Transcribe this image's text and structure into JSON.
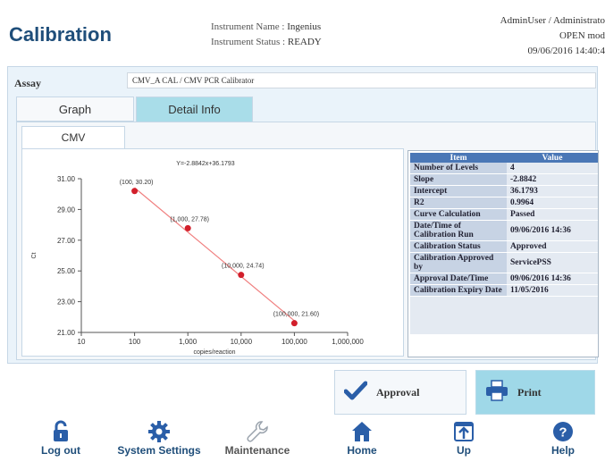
{
  "header": {
    "title": "Calibration",
    "instrument_name_label": "Instrument Name :",
    "instrument_name": "Ingenius",
    "instrument_status_label": "Instrument Status :",
    "instrument_status": "READY",
    "user": "AdminUser / Administrato",
    "mode": "OPEN mod",
    "datetime": "09/06/2016 14:40:4"
  },
  "assay": {
    "label": "Assay",
    "value": "CMV_A CAL / CMV PCR Calibrator"
  },
  "tabs": [
    {
      "label": "Graph",
      "active": false
    },
    {
      "label": "Detail Info",
      "active": true
    }
  ],
  "subtab": {
    "label": "CMV"
  },
  "chart_data": {
    "type": "scatter",
    "equation": "Y=-2.8842x+36.1793",
    "xlabel": "copies/reaction",
    "ylabel": "Ct",
    "x_scale": "log",
    "xlim": [
      10,
      1000000
    ],
    "ylim": [
      21,
      31
    ],
    "x_ticks": [
      "10",
      "100",
      "1,000",
      "10,000",
      "100,000",
      "1,000,000"
    ],
    "y_ticks": [
      "21.00",
      "23.00",
      "25.00",
      "27.00",
      "29.00",
      "31.00"
    ],
    "points": [
      {
        "x": 100,
        "y": 30.2,
        "label": "(100,   30.20)"
      },
      {
        "x": 1000,
        "y": 27.78,
        "label": "(1,000,   27.78)"
      },
      {
        "x": 10000,
        "y": 24.74,
        "label": "(10,000,   24.74)"
      },
      {
        "x": 100000,
        "y": 21.6,
        "label": "(100,000,   21.60)"
      }
    ],
    "fit_line": {
      "slope": -2.8842,
      "intercept": 36.1793,
      "x_range": [
        100,
        100000
      ]
    },
    "colors": {
      "points": "#d21f2b",
      "line": "#f08080"
    }
  },
  "detail": {
    "headers": [
      "Item",
      "Value"
    ],
    "rows": [
      {
        "item": "Number of Levels",
        "value": "4"
      },
      {
        "item": "Slope",
        "value": "-2.8842"
      },
      {
        "item": "Intercept",
        "value": "36.1793"
      },
      {
        "item": "R2",
        "value": "0.9964"
      },
      {
        "item": "Curve Calculation",
        "value": "Passed"
      },
      {
        "item": "Date/Time of Calibration Run",
        "value": "09/06/2016 14:36"
      },
      {
        "item": "Calibration Status",
        "value": "Approved"
      },
      {
        "item": "Calibration Approved by",
        "value": "ServicePSS"
      },
      {
        "item": "Approval Date/Time",
        "value": "09/06/2016 14:36"
      },
      {
        "item": "Calibration Expiry Date",
        "value": "11/05/2016"
      }
    ]
  },
  "buttons": {
    "approval": "Approval",
    "print": "Print"
  },
  "footer": [
    {
      "label": "Log out",
      "icon": "lock-icon"
    },
    {
      "label": "System Settings",
      "icon": "gear-icon"
    },
    {
      "label": "Maintenance",
      "icon": "wrench-icon"
    },
    {
      "label": "Home",
      "icon": "home-icon"
    },
    {
      "label": "Up",
      "icon": "up-icon"
    },
    {
      "label": "Help",
      "icon": "help-icon"
    }
  ],
  "colors": {
    "title": "#1f4e7a",
    "active_tab": "#a9dde9",
    "table_header": "#4a77b6",
    "print_button": "#9fd8e8"
  }
}
